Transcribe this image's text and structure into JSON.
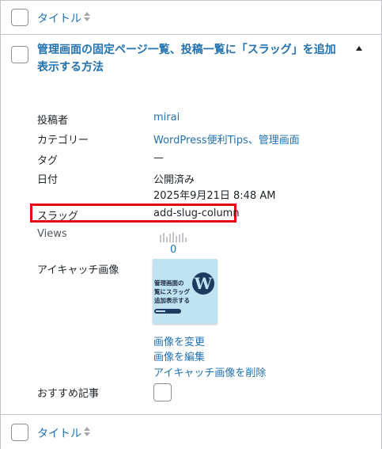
{
  "list_header": {
    "column_title": "タイトル"
  },
  "post": {
    "title": "管理画面の固定ページ一覧、投稿一覧に「スラッグ」を追加表示する方法",
    "fields": {
      "author_label": "投稿者",
      "author_value": "mirai",
      "category_label": "カテゴリー",
      "category_value": "WordPress便利Tips、管理画面",
      "tag_label": "タグ",
      "tag_value": "—",
      "date_label": "日付",
      "date_status": "公開済み",
      "date_value": "2025年9月21日 8:48 AM",
      "slug_label": "スラッグ",
      "slug_value": "add-slug-column",
      "views_label": "Views",
      "views_value": "0",
      "thumbnail_label": "アイキャッチ画像",
      "recommend_label": "おすすめ記事"
    },
    "thumbnail": {
      "text_line1": "管理画面の",
      "text_line2": "覧にスラッグ",
      "text_line3": "追加表示する",
      "logo_letter": "W"
    },
    "thumbnail_actions": {
      "change": "画像を変更",
      "edit": "画像を編集",
      "remove": "アイキャッチ画像を削除"
    }
  },
  "list_footer": {
    "column_title": "タイトル"
  },
  "colors": {
    "link": "#2271b1",
    "highlight": "#e60012",
    "thumbnail_bg": "#bfe3f1"
  }
}
